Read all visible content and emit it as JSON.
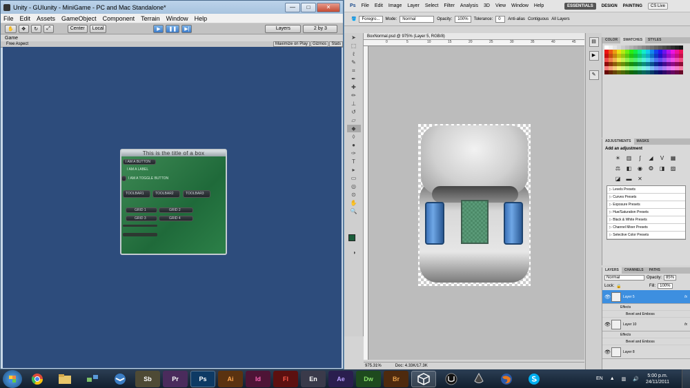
{
  "unity": {
    "title": "Unity - GUIunity - MiniGame - PC and Mac Standalone*",
    "window_min": "—",
    "window_max": "□",
    "window_close": "✕",
    "menu": [
      "File",
      "Edit",
      "Assets",
      "GameObject",
      "Component",
      "Terrain",
      "Window",
      "Help"
    ],
    "toolbar": {
      "pivot": "Center",
      "space": "Local",
      "layers": "Layers",
      "layout": "2 by 3"
    },
    "game_tab": "Game",
    "aspect": "Free Aspect",
    "game_buttons": [
      "Maximize on Play",
      "Gizmos",
      "Stats"
    ],
    "gui": {
      "box_title": "This is the title of a box",
      "button": "I am a button",
      "label": "I am a label",
      "toggle": "I am a toggle button",
      "toolbar": [
        "Toolbar1",
        "Toolbar2",
        "Toolbar3"
      ],
      "grid": [
        "Grid 1",
        "Grid 2",
        "Grid 3",
        "Grid 4"
      ]
    }
  },
  "ps": {
    "menu": [
      "File",
      "Edit",
      "Image",
      "Layer",
      "Select",
      "Filter",
      "Analysis",
      "3D",
      "View",
      "Window",
      "Help"
    ],
    "zoom_menu": "975%",
    "workspaces": [
      "ESSENTIALS",
      "DESIGN",
      "PAINTING"
    ],
    "cs_live": "CS Live",
    "options": {
      "preset": "Foregro...",
      "mode_label": "Mode:",
      "mode": "Normal",
      "opacity_label": "Opacity:",
      "opacity": "100%",
      "tolerance_label": "Tolerance:",
      "tolerance": "0",
      "anti_alias": "Anti-alias",
      "contiguous": "Contiguous",
      "all_layers": "All Layers"
    },
    "doc_tab": "BoxNormal.psd @ 975% (Layer 5, RGB/8)",
    "ruler_marks": [
      "0",
      "5",
      "10",
      "15",
      "20",
      "25",
      "30",
      "35",
      "40",
      "45"
    ],
    "status_zoom": "975.31%",
    "status_doc": "Doc: 4.33K/17.3K",
    "color_tabs": [
      "COLOR",
      "SWATCHES",
      "STYLES"
    ],
    "adj_tabs": [
      "ADJUSTMENTS",
      "MASKS"
    ],
    "adj_title": "Add an adjustment",
    "presets": [
      "Levels Presets",
      "Curves Presets",
      "Exposure Presets",
      "Hue/Saturation Presets",
      "Black & White Presets",
      "Channel Mixer Presets",
      "Selective Color Presets"
    ],
    "layer_tabs": [
      "LAYERS",
      "CHANNELS",
      "PATHS"
    ],
    "blend": "Normal",
    "layer_opacity_label": "Opacity:",
    "layer_opacity": "85%",
    "lock_label": "Lock:",
    "fill_label": "Fill:",
    "fill": "100%",
    "layers": [
      {
        "name": "Layer 5",
        "effects": "Effects",
        "effect": "Bevel and Emboss"
      },
      {
        "name": "Layer 10",
        "effects": "Effects",
        "effect": "Bevel and Emboss"
      },
      {
        "name": "Layer 8"
      }
    ],
    "fx": "fx"
  },
  "taskbar": {
    "apps": [
      "Sb",
      "Pr",
      "Ps",
      "Ai",
      "Id",
      "Fl",
      "En",
      "Ae",
      "Dw",
      "Br"
    ],
    "lang": "EN",
    "time": "5:00 p.m.",
    "date": "24/11/2011"
  },
  "colors": {
    "game_bg": "#2d4c7c",
    "gui_box": "#2c7a47",
    "selected_layer": "#3d8fe0"
  }
}
